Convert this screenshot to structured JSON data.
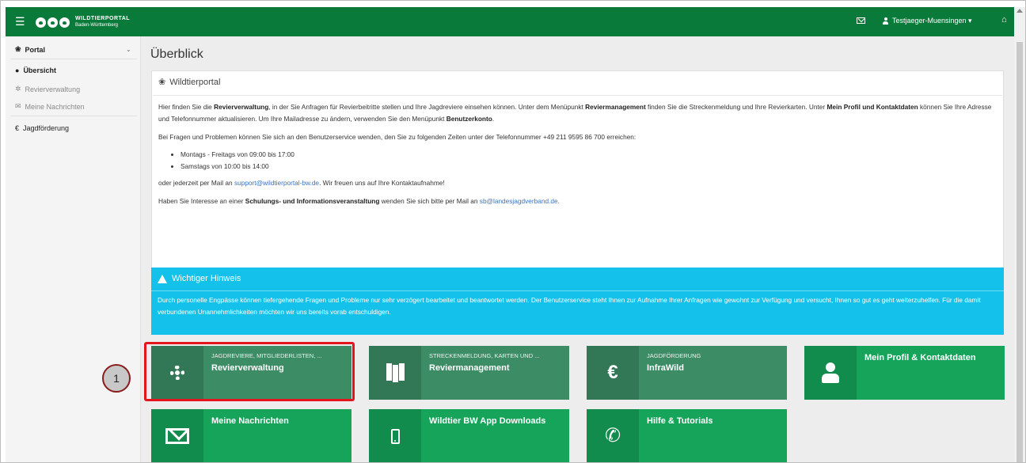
{
  "topbar": {
    "logo_line1": "WILDTIERPORTAL",
    "logo_line2": "Baden-Württemberg",
    "user": "Testjaeger-Muensingen ▾"
  },
  "sidebar": {
    "section": "Portal",
    "items": [
      {
        "label": "Übersicht"
      },
      {
        "label": "Revierverwaltung"
      },
      {
        "label": "Meine Nachrichten"
      },
      {
        "label": "Jagdförderung"
      }
    ]
  },
  "main": {
    "title": "Überblick",
    "panel": {
      "title": "Wildtierportal",
      "p1_a": "Hier finden Sie die ",
      "p1_b": "Revierverwaltung",
      "p1_c": ", in der Sie Anfragen für Revierbeitritte stellen und Ihre Jagdreviere einsehen können. Unter dem Menüpunkt ",
      "p1_d": "Reviermanagement",
      "p1_e": " finden Sie die Streckenmeldung und Ihre Revierkarten. Unter ",
      "p1_f": "Mein Profil und Kontaktdaten",
      "p1_g": " können Sie Ihre Adresse und Telefonnummer aktualisieren. Um Ihre Mailadresse zu ändern, verwenden Sie den Menüpunkt ",
      "p1_h": "Benutzerkonto",
      "p1_i": ".",
      "p2": "Bei Fragen und Problemen können Sie sich an den Benutzerservice wenden, den Sie zu folgenden Zeiten unter der Telefonnummer +49 211 9595 86 700 erreichen:",
      "bullets": [
        "Montags - Freitags von 09:00 bis 17:00",
        "Samstags von 10:00 bis 14:00"
      ],
      "p3_a": "oder jederzeit per Mail an ",
      "p3_link": "support@wildtierportal-bw.de",
      "p3_b": ". Wir freuen uns auf Ihre Kontaktaufnahme!",
      "p4_a": "Haben Sie Interesse an einer ",
      "p4_b": "Schulungs- und Informationsveranstaltung",
      "p4_c": " wenden Sie sich bitte per Mail an ",
      "p4_link": "sb@landesjagdverband.de",
      "p4_d": "."
    },
    "alert": {
      "title": "Wichtiger Hinweis",
      "text": "Durch personelle Engpässe können tiefergehende Fragen und Probleme nur sehr verzögert bearbeitet und beantwortet werden. Der Benutzerservice steht Ihnen zur Aufnahme Ihrer Anfragen wie gewohnt zur Verfügung und versucht, Ihnen so gut es geht weiterzuhelfen. Für die damit verbundenen Unannehmlichkeiten möchten wir uns bereits vorab entschuldigen."
    },
    "tiles": [
      {
        "sub": "JAGDREVIERE, MITGLIEDERLISTEN, ...",
        "title": "Revierverwaltung"
      },
      {
        "sub": "STRECKENMELDUNG, KARTEN UND ...",
        "title": "Reviermanagement"
      },
      {
        "sub": "JAGDFÖRDERUNG",
        "title": "InfraWild"
      },
      {
        "sub": "",
        "title": "Mein Profil & Kontaktdaten"
      },
      {
        "sub": "",
        "title": "Meine Nachrichten"
      },
      {
        "sub": "",
        "title": "Wildtier BW App Downloads"
      },
      {
        "sub": "",
        "title": "Hilfe & Tutorials"
      }
    ]
  },
  "callout": {
    "number": "1"
  },
  "colors": {
    "header": "#0a7a3a",
    "tile": "#16a45a",
    "alert": "#14c1ea",
    "highlight": "#e2161c"
  }
}
